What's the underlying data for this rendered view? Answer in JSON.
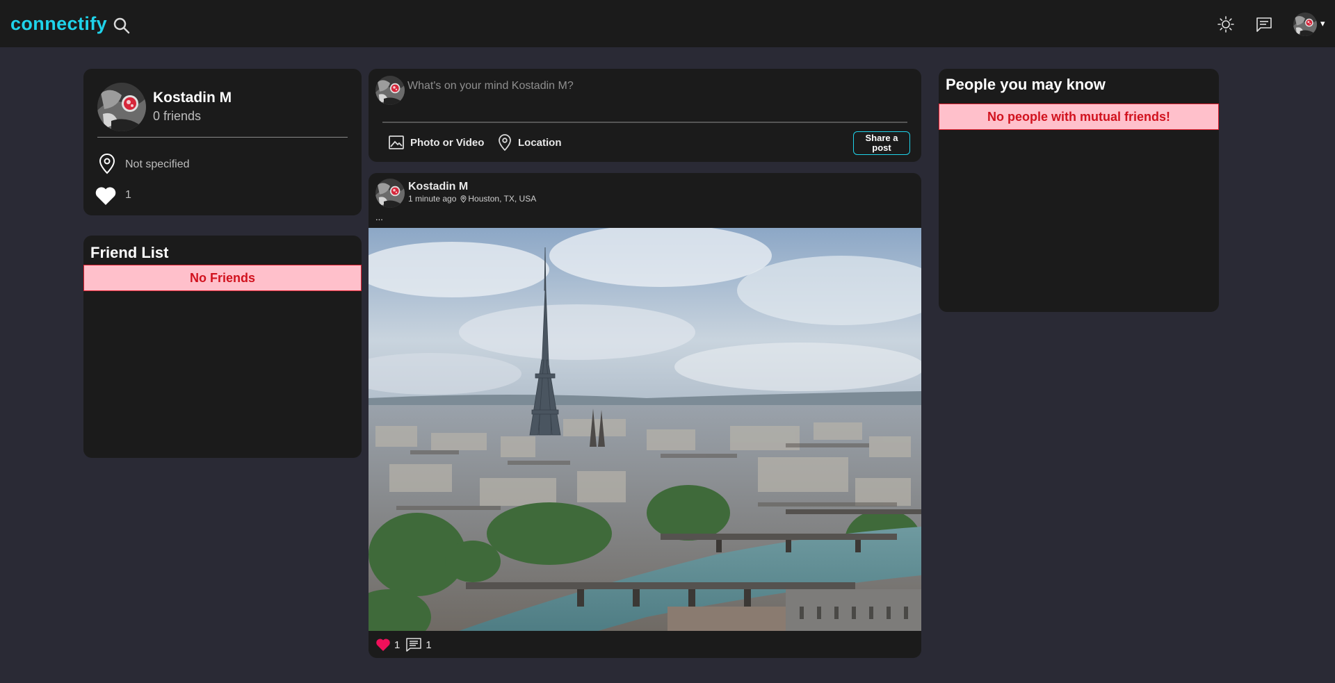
{
  "header": {
    "logo": "connectify",
    "icons": [
      "search-icon",
      "sun-icon",
      "message-icon",
      "avatar",
      "caret-down-icon"
    ],
    "caret": "▾"
  },
  "profile": {
    "name": "Kostadin M",
    "friends": "0 friends",
    "location": "Not specified",
    "likes": "1"
  },
  "friend_list": {
    "title": "Friend List",
    "empty": "No Friends"
  },
  "compose": {
    "placeholder": "What's on your mind Kostadin M?",
    "photo_label": "Photo or Video",
    "location_label": "Location",
    "share_label": "Share a post"
  },
  "post": {
    "author": "Kostadin M",
    "time": "1 minute ago",
    "location": "Houston, TX, USA",
    "text": "...",
    "likes": "1",
    "comments": "1"
  },
  "people": {
    "title": "People you may know",
    "empty": "No people with mutual friends!"
  },
  "colors": {
    "accent": "#1fd3ea",
    "background": "#2a2a35",
    "card": "#1b1b1b",
    "alert_bg": "#ffc0cb",
    "alert_text": "#d1121e",
    "like": "#f0105a"
  }
}
